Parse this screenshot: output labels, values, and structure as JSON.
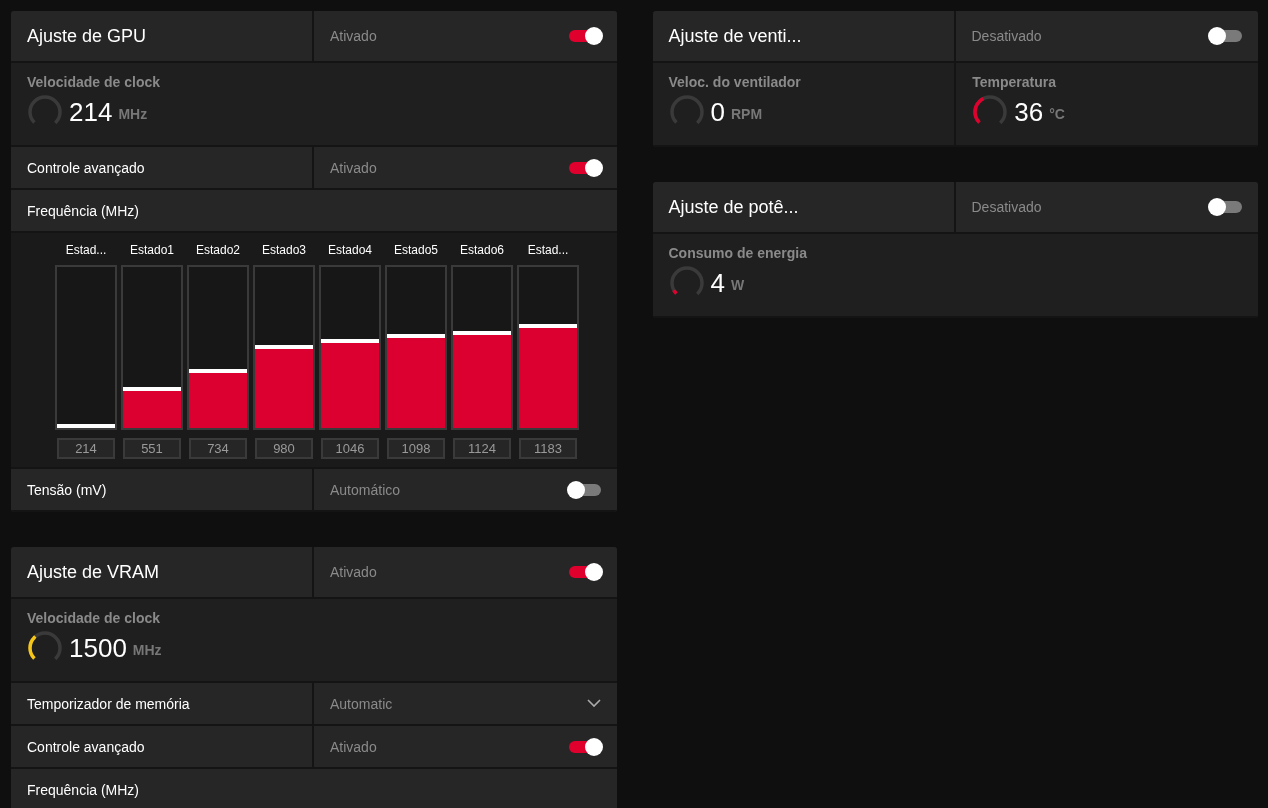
{
  "left_column": [
    {
      "title": "Ajuste de GPU",
      "status": "Ativado",
      "on": true,
      "sections": [
        {
          "kind": "metrics",
          "items": [
            {
              "label": "Velocidade de clock",
              "value": "214",
              "unit": "MHz",
              "level": 0
            }
          ]
        },
        {
          "kind": "toggle",
          "label": "Controle avançado",
          "status": "Ativado",
          "on": true
        },
        {
          "kind": "heading",
          "label": "Frequência (MHz)"
        },
        {
          "kind": "states",
          "items": [
            {
              "label": "Estad...",
              "level": 0,
              "value": "214"
            },
            {
              "label": "Estado1",
              "level": 0.23,
              "value": "551"
            },
            {
              "label": "Estado2",
              "level": 0.34,
              "value": "734"
            },
            {
              "label": "Estado3",
              "level": 0.49,
              "value": "980"
            },
            {
              "label": "Estado4",
              "level": 0.53,
              "value": "1046"
            },
            {
              "label": "Estado5",
              "level": 0.56,
              "value": "1098"
            },
            {
              "label": "Estado6",
              "level": 0.58,
              "value": "1124"
            },
            {
              "label": "Estad...",
              "level": 0.62,
              "value": "1183"
            }
          ]
        },
        {
          "kind": "toggle",
          "label": "Tensão (mV)",
          "status": "Automático",
          "on": false
        }
      ]
    },
    {
      "title": "Ajuste de VRAM",
      "status": "Ativado",
      "on": true,
      "sections": [
        {
          "kind": "metrics",
          "items": [
            {
              "label": "Velocidade de clock",
              "value": "1500",
              "unit": "MHz",
              "level": 0.35,
              "color": "#f5c518"
            }
          ]
        },
        {
          "kind": "dropdown",
          "label": "Temporizador de memória",
          "value": "Automatic"
        },
        {
          "kind": "toggle",
          "label": "Controle avançado",
          "status": "Ativado",
          "on": true
        },
        {
          "kind": "heading",
          "label": "Frequência (MHz)"
        }
      ]
    }
  ],
  "right_column": [
    {
      "title": "Ajuste de venti...",
      "status": "Desativado",
      "on": false,
      "sections": [
        {
          "kind": "metrics",
          "items": [
            {
              "label": "Veloc. do ventilador",
              "value": "0",
              "unit": "RPM",
              "level": 0
            },
            {
              "label": "Temperatura",
              "value": "36",
              "unit": "°C",
              "level": 0.4,
              "color": "#e0002e"
            }
          ]
        }
      ]
    },
    {
      "title": "Ajuste de potê...",
      "status": "Desativado",
      "on": false,
      "sections": [
        {
          "kind": "metrics",
          "items": [
            {
              "label": "Consumo de energia",
              "value": "4",
              "unit": "W",
              "level": 0.06,
              "color": "#e0002e"
            }
          ]
        }
      ]
    }
  ]
}
